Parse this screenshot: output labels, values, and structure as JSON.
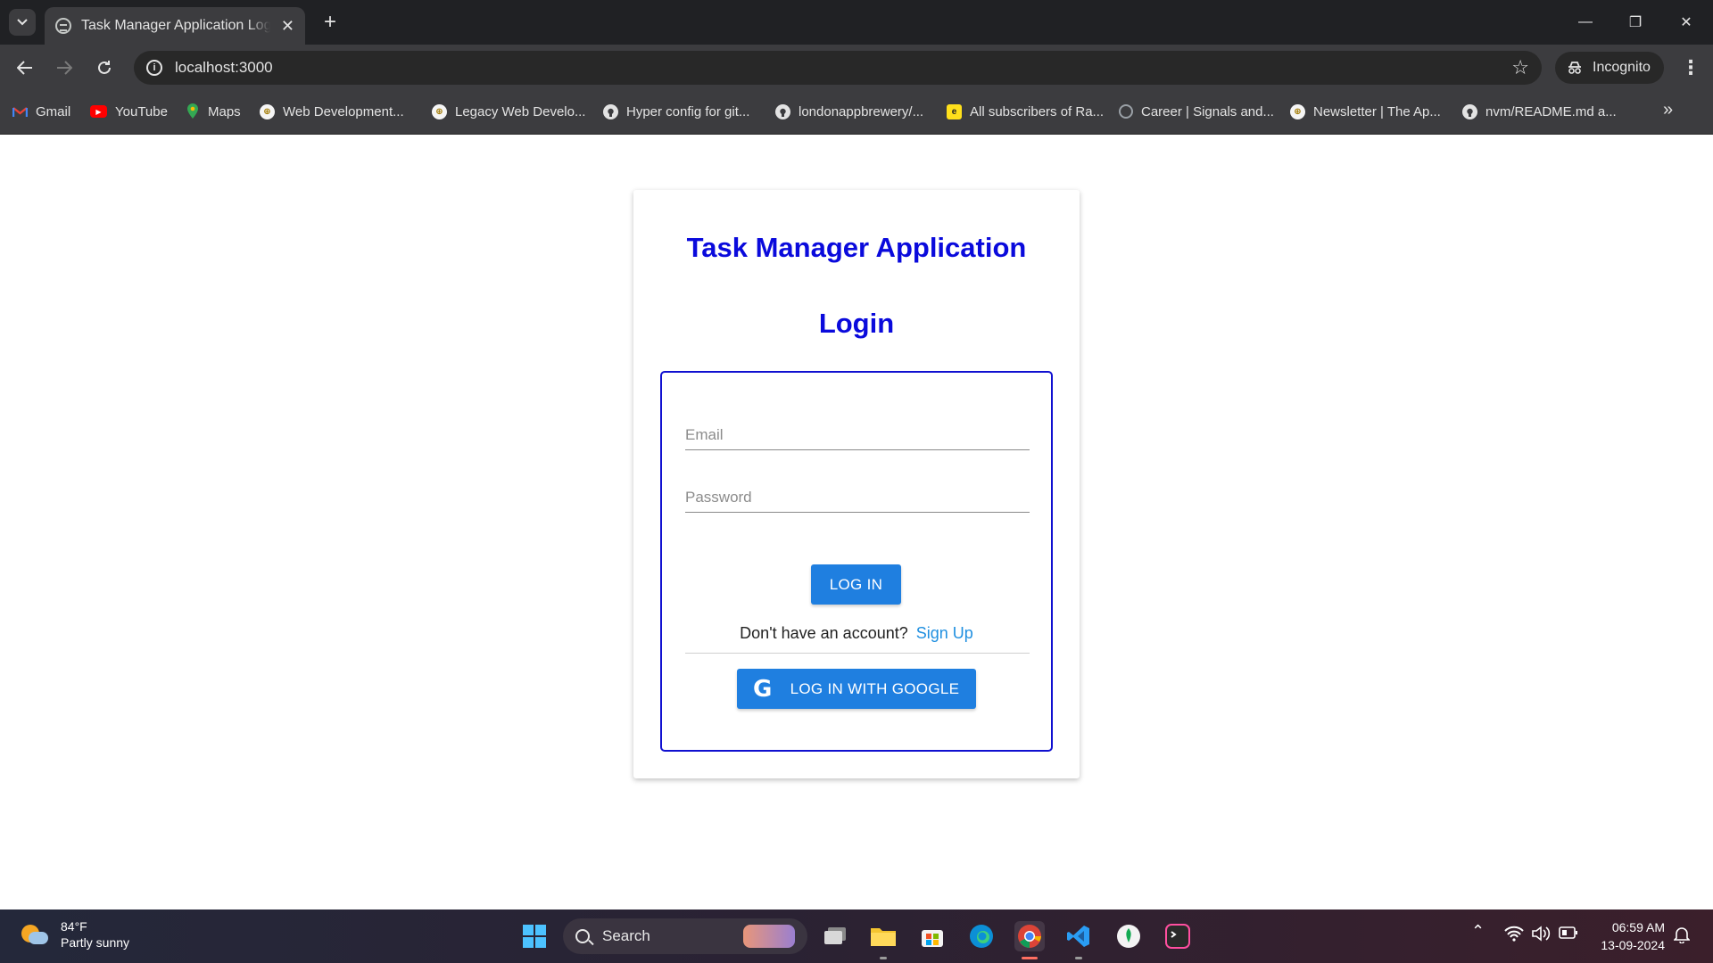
{
  "browser": {
    "tab_title": "Task Manager Application Login",
    "tab_close": "✕",
    "new_tab": "+",
    "url": "localhost:3000",
    "incognito_label": "Incognito",
    "window_controls": [
      "—",
      "❐",
      "✕"
    ]
  },
  "bookmarks": [
    {
      "label": "Gmail",
      "icon": "gmail-icon",
      "color": "#ea4335"
    },
    {
      "label": "YouTube",
      "icon": "youtube-icon",
      "color": "#ff0000"
    },
    {
      "label": "Maps",
      "icon": "maps-icon",
      "color": "#34a853"
    },
    {
      "label": "Web Development...",
      "icon": "udemy-icon",
      "color": "#f0c030"
    },
    {
      "label": "Legacy Web Develo...",
      "icon": "udemy-icon",
      "color": "#f0c030"
    },
    {
      "label": "Hyper config for git...",
      "icon": "github-icon",
      "color": "#e3e3e3"
    },
    {
      "label": "londonappbrewery/...",
      "icon": "github-icon",
      "color": "#e3e3e3"
    },
    {
      "label": "All subscribers of Ra...",
      "icon": "mailchimp-icon",
      "color": "#ffe01b"
    },
    {
      "label": "Career | Signals and...",
      "icon": "globe-icon",
      "color": "#9aa0a6"
    },
    {
      "label": "Newsletter | The Ap...",
      "icon": "udemy-icon",
      "color": "#f0c030"
    },
    {
      "label": "nvm/README.md a...",
      "icon": "github-icon",
      "color": "#e3e3e3"
    }
  ],
  "page": {
    "app_title": "Task Manager Application",
    "login_title": "Login",
    "email_placeholder": "Email",
    "password_placeholder": "Password",
    "login_button": "LOG IN",
    "no_account_text": "Don't have an account?",
    "signup_link": "Sign Up",
    "google_button": "LOG IN WITH GOOGLE",
    "google_glyph": "G"
  },
  "taskbar": {
    "weather_temp": "84°F",
    "weather_desc": "Partly sunny",
    "search_label": "Search",
    "time": "06:59 AM",
    "date": "13-09-2024"
  },
  "colors": {
    "heading": "#0a0adc",
    "button": "#1f7fe0",
    "link": "#1f8fe0",
    "form_border": "#1010d0"
  }
}
